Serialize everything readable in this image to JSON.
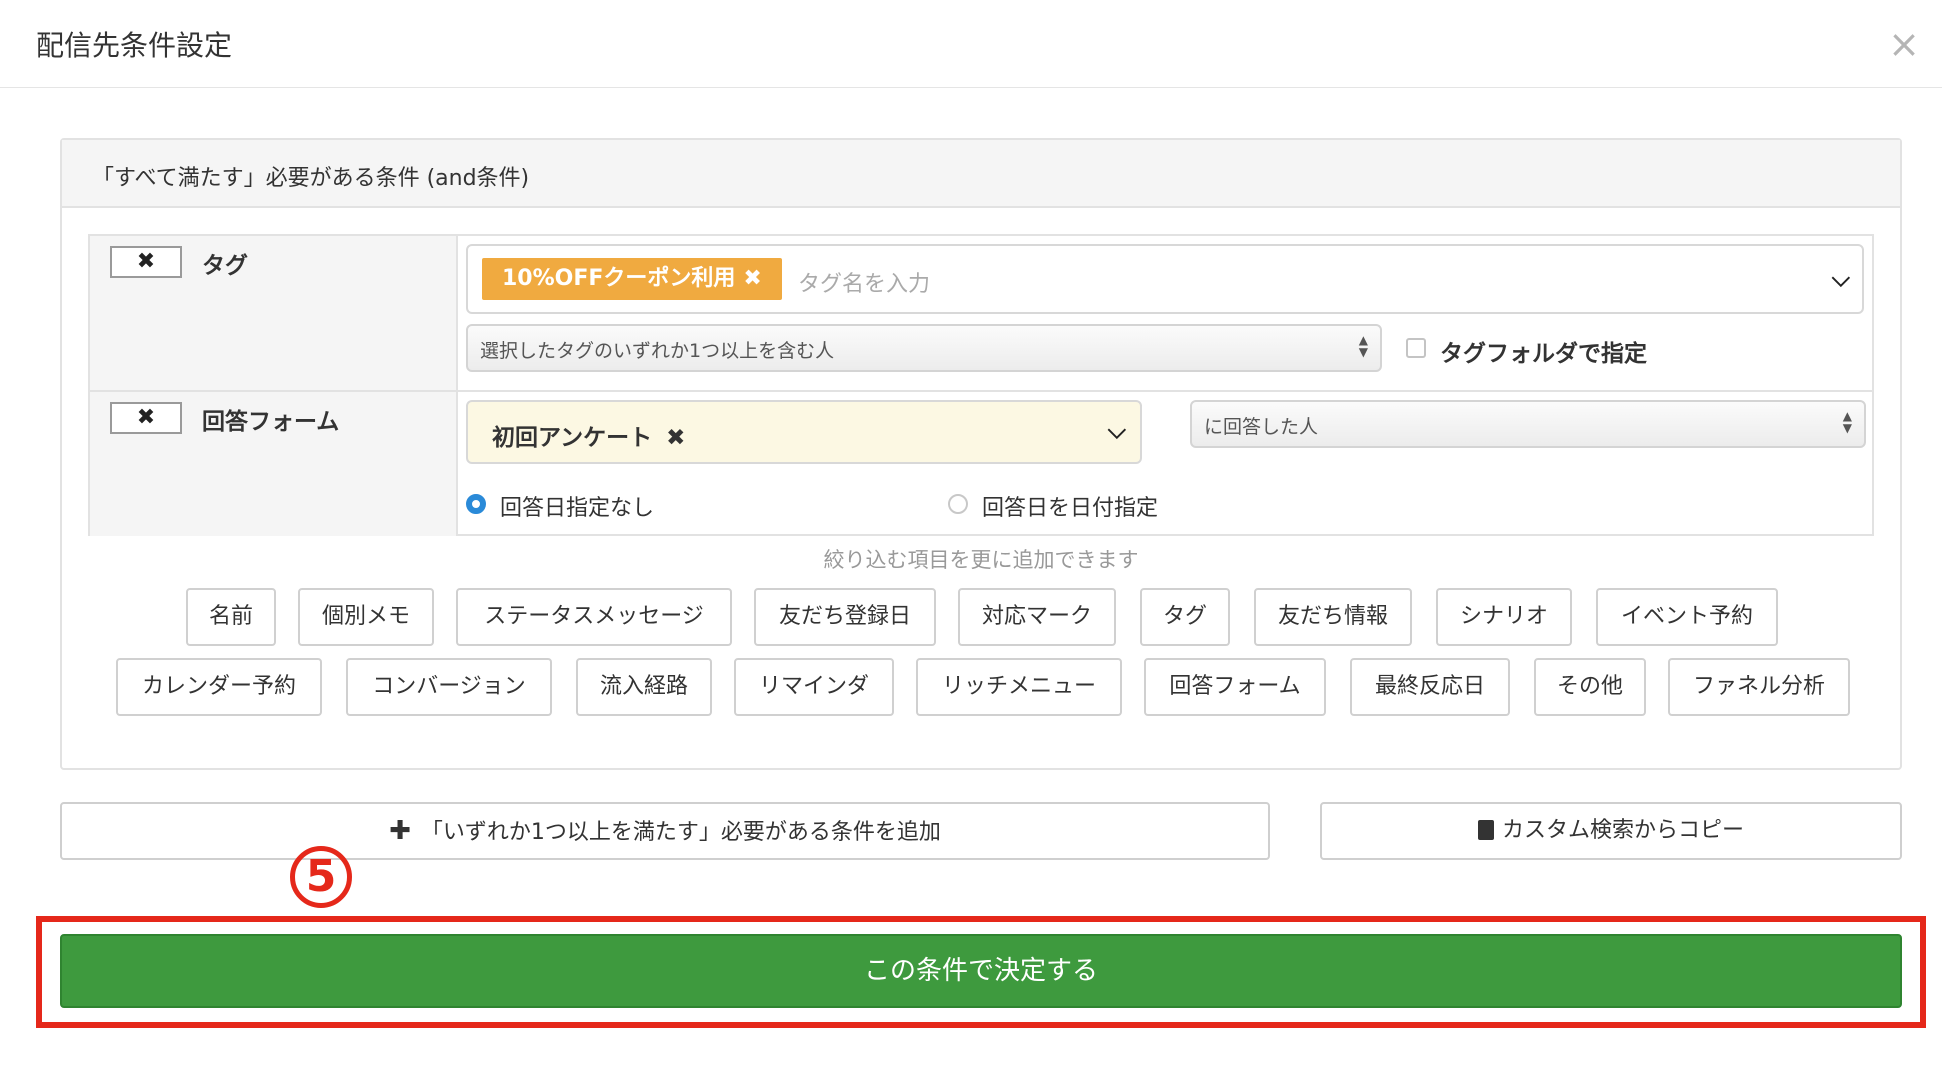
{
  "modal": {
    "title": "配信先条件設定",
    "close_label": "×"
  },
  "and_group": {
    "heading": "「すべて満たす」必要がある条件 (and条件)",
    "conditions": {
      "tag": {
        "remove_label": "✖",
        "name": "タグ",
        "selected_tag": "10%OFFクーポン利用",
        "chip_remove": "✖",
        "placeholder": "タグ名を入力",
        "match_mode": "選択したタグのいずれか1つ以上を含む人",
        "folder_label": "タグフォルダで指定"
      },
      "form": {
        "remove_label": "✖",
        "name": "回答フォーム",
        "selected_form": "初回アンケート",
        "chip_remove": "✖",
        "answer_mode": "に回答した人",
        "radio_no_date": "回答日指定なし",
        "radio_by_date": "回答日を日付指定"
      }
    },
    "hint": "絞り込む項目を更に追加できます",
    "filters_row1": [
      "名前",
      "個別メモ",
      "ステータスメッセージ",
      "友だち登録日",
      "対応マーク",
      "タグ",
      "友だち情報",
      "シナリオ",
      "イベント予約"
    ],
    "filters_row2": [
      "カレンダー予約",
      "コンバージョン",
      "流入経路",
      "リマインダ",
      "リッチメニュー",
      "回答フォーム",
      "最終反応日",
      "その他",
      "ファネル分析"
    ]
  },
  "actions": {
    "add_or_plus": "✚",
    "add_or_label": "「いずれか1つ以上を満たす」必要がある条件を追加",
    "copy_label": "カスタム検索からコピー",
    "submit_label": "この条件で決定する"
  },
  "annotation": {
    "step_number": "5"
  },
  "colors": {
    "tag_chip": "#f0aa40",
    "form_select_bg": "#fcf8e3",
    "submit": "#3e9a3e",
    "annotation": "#e5281a",
    "radio_on": "#2a8ad8"
  }
}
